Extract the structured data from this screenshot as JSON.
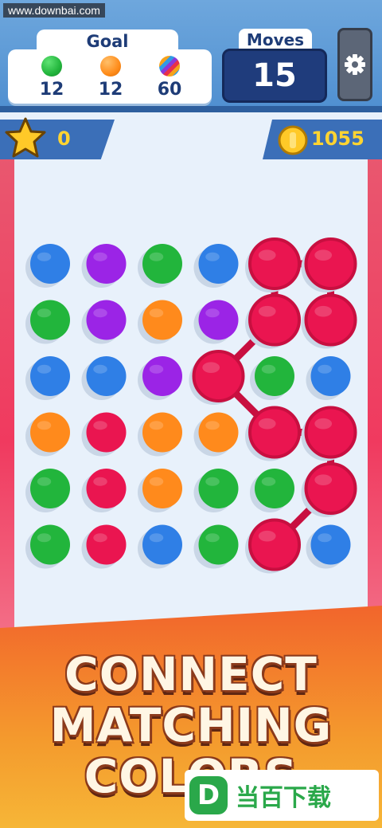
{
  "watermark": "www.downbai.com",
  "goal": {
    "title": "Goal",
    "items": [
      {
        "icon": "green-ball-icon",
        "color": "#22b53c",
        "count": "12"
      },
      {
        "icon": "orange-ball-icon",
        "color": "#ff8c1a",
        "count": "12"
      },
      {
        "icon": "rainbow-ball-icon",
        "color": "#d04da8",
        "count": "60"
      }
    ]
  },
  "moves": {
    "label": "Moves",
    "value": "15"
  },
  "settings": {
    "icon": "gear-icon"
  },
  "stars": {
    "icon": "star-icon",
    "value": "0"
  },
  "coins": {
    "icon": "coin-icon",
    "value": "1055"
  },
  "board": {
    "colors": {
      "B": "#2f7fe6",
      "P": "#9b24e6",
      "G": "#22b53c",
      "O": "#ff8a1c",
      "R": "#ea1550"
    },
    "rows": [
      [
        "B",
        "P",
        "G",
        "B",
        "R",
        "R"
      ],
      [
        "G",
        "P",
        "O",
        "P",
        "R",
        "R"
      ],
      [
        "B",
        "B",
        "P",
        "R",
        "G",
        "B"
      ],
      [
        "O",
        "R",
        "O",
        "O",
        "R",
        "R"
      ],
      [
        "G",
        "R",
        "O",
        "G",
        "G",
        "R"
      ],
      [
        "G",
        "R",
        "B",
        "G",
        "R",
        "B"
      ]
    ],
    "path": [
      [
        5,
        4
      ],
      [
        4,
        5
      ],
      [
        3,
        5
      ],
      [
        3,
        4
      ],
      [
        2,
        3
      ],
      [
        1,
        4
      ],
      [
        0,
        4
      ],
      [
        0,
        5
      ],
      [
        1,
        5
      ]
    ],
    "link_color": "#c80f40"
  },
  "banner": {
    "lines": [
      "CONNECT",
      "MATCHING",
      "COLORS"
    ]
  },
  "logo": {
    "letter": "D",
    "text": "当百下载"
  }
}
